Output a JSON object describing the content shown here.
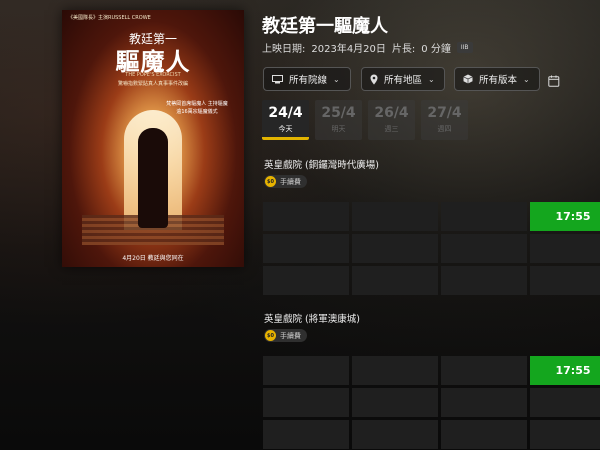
{
  "movie": {
    "title": "教廷第一驅魔人",
    "release_label": "上映日期:",
    "release_date": "2023年4月20日",
    "duration_label": "片長:",
    "duration": "0 分鐘",
    "rating": "IIB"
  },
  "poster": {
    "top_credit": "《美國隊長》主演RUSSELL CROWE",
    "title_line1": "教廷第一",
    "title_line2": "驅魔人",
    "english_title": "THE POPE'S EXORCIST",
    "tagline": "驚嚇指數緊貼真人真事事件改編",
    "side_text": "梵蒂岡首席驅魔人 主持驅魔逾16萬宗驅魔儀式",
    "date_text": "4月20日 教廷與您同在"
  },
  "filters": [
    {
      "label": "所有院線",
      "icon": "cinema-icon"
    },
    {
      "label": "所有地區",
      "icon": "location-pin-icon"
    },
    {
      "label": "所有版本",
      "icon": "cube-icon"
    }
  ],
  "dates": [
    {
      "day": "24/4",
      "weekday": "今天",
      "active": true
    },
    {
      "day": "25/4",
      "weekday": "明天",
      "active": false
    },
    {
      "day": "26/4",
      "weekday": "週三",
      "active": false
    },
    {
      "day": "27/4",
      "weekday": "週四",
      "active": false
    }
  ],
  "cinemas": [
    {
      "name": "英皇戲院 (銅鑼灣時代廣場)",
      "fee_coin": "$0",
      "fee_label": "手續費",
      "showtime": "17:55"
    },
    {
      "name": "英皇戲院 (將軍澳康城)",
      "fee_coin": "$0",
      "fee_label": "手續費",
      "showtime": "17:55"
    }
  ],
  "colors": {
    "accent": "#e2b400",
    "showtime": "#14a61e"
  }
}
